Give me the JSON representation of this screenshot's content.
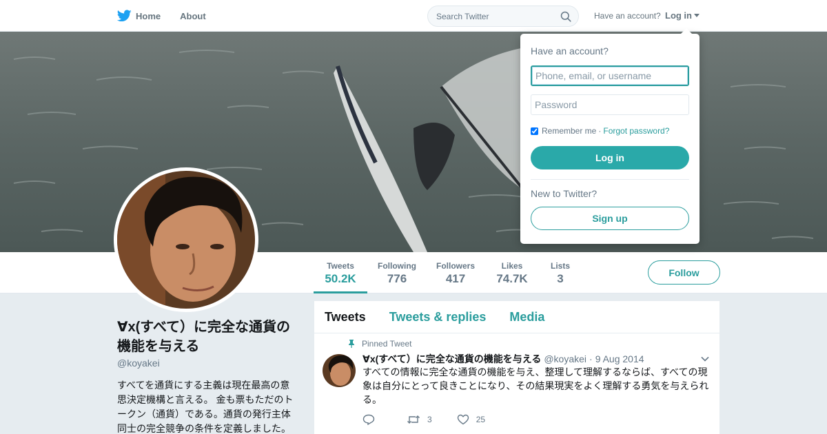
{
  "nav": {
    "home_label": "Home",
    "about_label": "About",
    "search_placeholder": "Search Twitter",
    "account_prompt": "Have an account?",
    "login_label": "Log in"
  },
  "profile": {
    "display_name": "∀x(すべて）に完全な通貨の機能を与える",
    "handle": "@koyakei",
    "bio": "すべてを通貨にする主義は現在最高の意思決定機構と言える。 金も票もただのトークン（通貨）である。通貨の発行主体同士の完全競争の条件を定義しました。"
  },
  "stats": [
    {
      "label": "Tweets",
      "value": "50.2K"
    },
    {
      "label": "Following",
      "value": "776"
    },
    {
      "label": "Followers",
      "value": "417"
    },
    {
      "label": "Likes",
      "value": "74.7K"
    },
    {
      "label": "Lists",
      "value": "3"
    }
  ],
  "follow_label": "Follow",
  "timeline": {
    "tabs": [
      "Tweets",
      "Tweets & replies",
      "Media"
    ],
    "pinned_label": "Pinned Tweet",
    "tweet": {
      "author": "∀x(すべて）に完全な通貨の機能を与える",
      "handle": "@koyakei",
      "dot": "·",
      "date": "9 Aug 2014",
      "text": "すべての情報に完全な通貨の機能を与え、整理して理解するならば、すべての現象は自分にとって良きことになり、その結果現実をよく理解する勇気を与えられる。",
      "retweets": "3",
      "likes": "25"
    }
  },
  "login_dropdown": {
    "title": "Have an account?",
    "username_placeholder": "Phone, email, or username",
    "password_placeholder": "Password",
    "remember_label": "Remember me",
    "separator": "·",
    "forgot_label": "Forgot password?",
    "login_button": "Log in",
    "new_prompt": "New to Twitter?",
    "signup_button": "Sign up"
  },
  "colors": {
    "accent": "#2a9d9d",
    "twitter_blue": "#1da1f2"
  }
}
